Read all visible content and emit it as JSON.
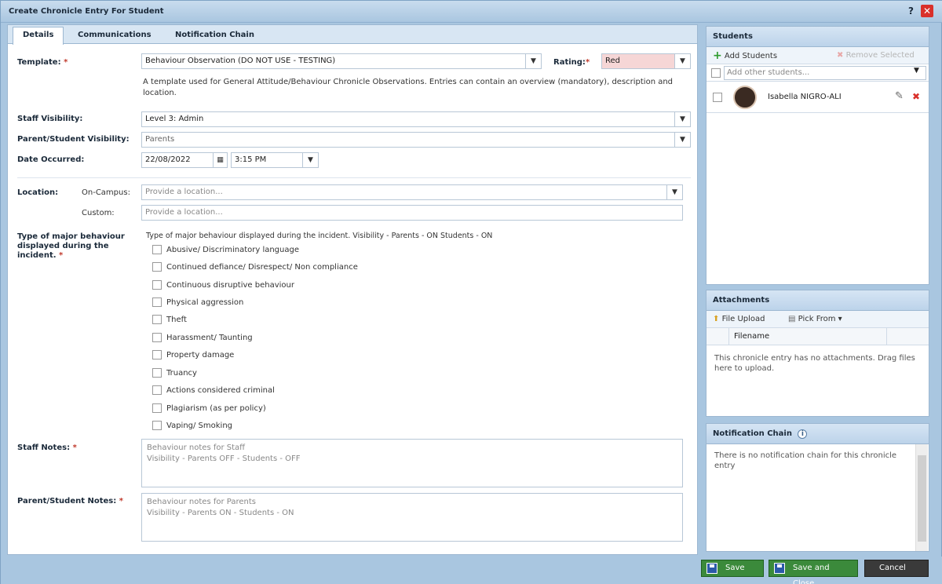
{
  "window": {
    "title": "Create Chronicle Entry For Student",
    "help": "?",
    "close": "✕"
  },
  "tabs": [
    {
      "label": "Details"
    },
    {
      "label": "Communications"
    },
    {
      "label": "Notification Chain"
    }
  ],
  "form": {
    "template_label": "Template:",
    "template_value": "Behaviour Observation (DO NOT USE - TESTING)",
    "rating_label": "Rating:",
    "rating_value": "Red",
    "template_description": "A template used for General Attitude/Behaviour Chronicle Observations. Entries can contain an overview (mandatory), description and location.",
    "staff_visibility_label": "Staff Visibility:",
    "staff_visibility_value": "Level 3: Admin",
    "parent_visibility_label": "Parent/Student Visibility:",
    "parent_visibility_value": "Parents",
    "date_label": "Date Occurred:",
    "date_value": "22/08/2022",
    "time_value": "3:15 PM",
    "location_label": "Location:",
    "on_campus_label": "On-Campus:",
    "on_campus_placeholder": "Provide a location...",
    "custom_label": "Custom:",
    "custom_placeholder": "Provide a location...",
    "behaviour_label": "Type of major behaviour displayed during the incident.",
    "behaviour_hint": "Type of major behaviour displayed during the incident. Visibility - Parents - ON Students - ON",
    "behaviours": [
      "Abusive/ Discriminatory language",
      "Continued defiance/ Disrespect/ Non compliance",
      "Continuous disruptive behaviour",
      "Physical aggression",
      "Theft",
      "Harassment/ Taunting",
      "Property damage",
      "Truancy",
      "Actions considered criminal",
      "Plagiarism (as per policy)",
      "Vaping/ Smoking"
    ],
    "staff_notes_label": "Staff Notes:",
    "staff_notes_placeholder_1": "Behaviour notes for Staff",
    "staff_notes_placeholder_2": "Visibility - Parents OFF - Students - OFF",
    "parent_notes_label": "Parent/Student Notes:",
    "parent_notes_placeholder_1": "Behaviour notes for Parents",
    "parent_notes_placeholder_2": "Visibility - Parents ON - Students - ON",
    "required_mark": "*"
  },
  "students": {
    "header": "Students",
    "add_label": "Add Students",
    "remove_label": "Remove Selected",
    "add_other_placeholder": "Add other students...",
    "student_name": "Isabella NIGRO-ALI"
  },
  "attachments": {
    "header": "Attachments",
    "file_upload": "File Upload",
    "pick_from": "Pick From",
    "column_filename": "Filename",
    "empty_text": "This chronicle entry has no attachments. Drag files here to upload."
  },
  "notification": {
    "header": "Notification Chain",
    "info": "i",
    "empty_text": "There is no notification chain for this chronicle entry"
  },
  "footer": {
    "save": "Save",
    "save_close": "Save and Close",
    "cancel": "Cancel"
  },
  "colors": {
    "rating_bg": "#f6d6d6",
    "accent_green": "#3b8a3b"
  }
}
